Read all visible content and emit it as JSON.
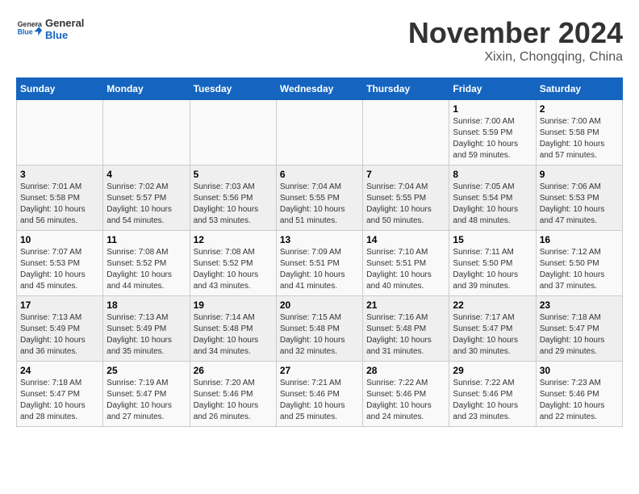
{
  "header": {
    "logo": {
      "general": "General",
      "blue": "Blue"
    },
    "title": "November 2024",
    "location": "Xixin, Chongqing, China"
  },
  "days_of_week": [
    "Sunday",
    "Monday",
    "Tuesday",
    "Wednesday",
    "Thursday",
    "Friday",
    "Saturday"
  ],
  "weeks": [
    [
      {
        "day": "",
        "info": ""
      },
      {
        "day": "",
        "info": ""
      },
      {
        "day": "",
        "info": ""
      },
      {
        "day": "",
        "info": ""
      },
      {
        "day": "",
        "info": ""
      },
      {
        "day": "1",
        "info": "Sunrise: 7:00 AM\nSunset: 5:59 PM\nDaylight: 10 hours and 59 minutes."
      },
      {
        "day": "2",
        "info": "Sunrise: 7:00 AM\nSunset: 5:58 PM\nDaylight: 10 hours and 57 minutes."
      }
    ],
    [
      {
        "day": "3",
        "info": "Sunrise: 7:01 AM\nSunset: 5:58 PM\nDaylight: 10 hours and 56 minutes."
      },
      {
        "day": "4",
        "info": "Sunrise: 7:02 AM\nSunset: 5:57 PM\nDaylight: 10 hours and 54 minutes."
      },
      {
        "day": "5",
        "info": "Sunrise: 7:03 AM\nSunset: 5:56 PM\nDaylight: 10 hours and 53 minutes."
      },
      {
        "day": "6",
        "info": "Sunrise: 7:04 AM\nSunset: 5:55 PM\nDaylight: 10 hours and 51 minutes."
      },
      {
        "day": "7",
        "info": "Sunrise: 7:04 AM\nSunset: 5:55 PM\nDaylight: 10 hours and 50 minutes."
      },
      {
        "day": "8",
        "info": "Sunrise: 7:05 AM\nSunset: 5:54 PM\nDaylight: 10 hours and 48 minutes."
      },
      {
        "day": "9",
        "info": "Sunrise: 7:06 AM\nSunset: 5:53 PM\nDaylight: 10 hours and 47 minutes."
      }
    ],
    [
      {
        "day": "10",
        "info": "Sunrise: 7:07 AM\nSunset: 5:53 PM\nDaylight: 10 hours and 45 minutes."
      },
      {
        "day": "11",
        "info": "Sunrise: 7:08 AM\nSunset: 5:52 PM\nDaylight: 10 hours and 44 minutes."
      },
      {
        "day": "12",
        "info": "Sunrise: 7:08 AM\nSunset: 5:52 PM\nDaylight: 10 hours and 43 minutes."
      },
      {
        "day": "13",
        "info": "Sunrise: 7:09 AM\nSunset: 5:51 PM\nDaylight: 10 hours and 41 minutes."
      },
      {
        "day": "14",
        "info": "Sunrise: 7:10 AM\nSunset: 5:51 PM\nDaylight: 10 hours and 40 minutes."
      },
      {
        "day": "15",
        "info": "Sunrise: 7:11 AM\nSunset: 5:50 PM\nDaylight: 10 hours and 39 minutes."
      },
      {
        "day": "16",
        "info": "Sunrise: 7:12 AM\nSunset: 5:50 PM\nDaylight: 10 hours and 37 minutes."
      }
    ],
    [
      {
        "day": "17",
        "info": "Sunrise: 7:13 AM\nSunset: 5:49 PM\nDaylight: 10 hours and 36 minutes."
      },
      {
        "day": "18",
        "info": "Sunrise: 7:13 AM\nSunset: 5:49 PM\nDaylight: 10 hours and 35 minutes."
      },
      {
        "day": "19",
        "info": "Sunrise: 7:14 AM\nSunset: 5:48 PM\nDaylight: 10 hours and 34 minutes."
      },
      {
        "day": "20",
        "info": "Sunrise: 7:15 AM\nSunset: 5:48 PM\nDaylight: 10 hours and 32 minutes."
      },
      {
        "day": "21",
        "info": "Sunrise: 7:16 AM\nSunset: 5:48 PM\nDaylight: 10 hours and 31 minutes."
      },
      {
        "day": "22",
        "info": "Sunrise: 7:17 AM\nSunset: 5:47 PM\nDaylight: 10 hours and 30 minutes."
      },
      {
        "day": "23",
        "info": "Sunrise: 7:18 AM\nSunset: 5:47 PM\nDaylight: 10 hours and 29 minutes."
      }
    ],
    [
      {
        "day": "24",
        "info": "Sunrise: 7:18 AM\nSunset: 5:47 PM\nDaylight: 10 hours and 28 minutes."
      },
      {
        "day": "25",
        "info": "Sunrise: 7:19 AM\nSunset: 5:47 PM\nDaylight: 10 hours and 27 minutes."
      },
      {
        "day": "26",
        "info": "Sunrise: 7:20 AM\nSunset: 5:46 PM\nDaylight: 10 hours and 26 minutes."
      },
      {
        "day": "27",
        "info": "Sunrise: 7:21 AM\nSunset: 5:46 PM\nDaylight: 10 hours and 25 minutes."
      },
      {
        "day": "28",
        "info": "Sunrise: 7:22 AM\nSunset: 5:46 PM\nDaylight: 10 hours and 24 minutes."
      },
      {
        "day": "29",
        "info": "Sunrise: 7:22 AM\nSunset: 5:46 PM\nDaylight: 10 hours and 23 minutes."
      },
      {
        "day": "30",
        "info": "Sunrise: 7:23 AM\nSunset: 5:46 PM\nDaylight: 10 hours and 22 minutes."
      }
    ]
  ]
}
